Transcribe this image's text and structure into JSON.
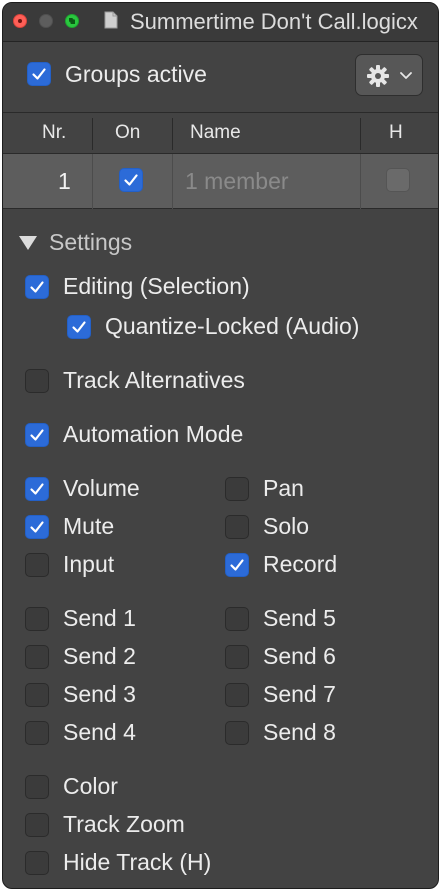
{
  "window": {
    "title": "Summertime Don't Call.logicx"
  },
  "groups": {
    "active_label": "Groups active",
    "active_checked": true
  },
  "table": {
    "columns": [
      "Nr.",
      "On",
      "Name",
      "H"
    ],
    "rows": [
      {
        "nr": "1",
        "on": true,
        "name_placeholder": "1 member",
        "hidden": false
      }
    ]
  },
  "settings": {
    "title": "Settings",
    "editing": {
      "label": "Editing (Selection)",
      "checked": true
    },
    "quantize_locked": {
      "label": "Quantize-Locked (Audio)",
      "checked": true
    },
    "track_alternatives": {
      "label": "Track Alternatives",
      "checked": false
    },
    "automation_mode": {
      "label": "Automation Mode",
      "checked": true
    },
    "params_left": [
      {
        "label": "Volume",
        "checked": true
      },
      {
        "label": "Mute",
        "checked": true
      },
      {
        "label": "Input",
        "checked": false
      }
    ],
    "params_right": [
      {
        "label": "Pan",
        "checked": false
      },
      {
        "label": "Solo",
        "checked": false
      },
      {
        "label": "Record",
        "checked": true
      }
    ],
    "sends_left": [
      {
        "label": "Send 1",
        "checked": false
      },
      {
        "label": "Send 2",
        "checked": false
      },
      {
        "label": "Send 3",
        "checked": false
      },
      {
        "label": "Send 4",
        "checked": false
      }
    ],
    "sends_right": [
      {
        "label": "Send 5",
        "checked": false
      },
      {
        "label": "Send 6",
        "checked": false
      },
      {
        "label": "Send 7",
        "checked": false
      },
      {
        "label": "Send 8",
        "checked": false
      }
    ],
    "color": {
      "label": "Color",
      "checked": false
    },
    "track_zoom": {
      "label": "Track Zoom",
      "checked": false
    },
    "hide_track": {
      "label": "Hide Track (H)",
      "checked": false
    }
  },
  "colors": {
    "accent": "#2c6bd8",
    "window_bg": "#434343",
    "row_bg": "#5d5d5d",
    "text": "#ececec"
  },
  "icons": {
    "gear": "gear-icon",
    "chevron": "chevron-down-icon",
    "disclosure": "disclosure-triangle-icon"
  }
}
